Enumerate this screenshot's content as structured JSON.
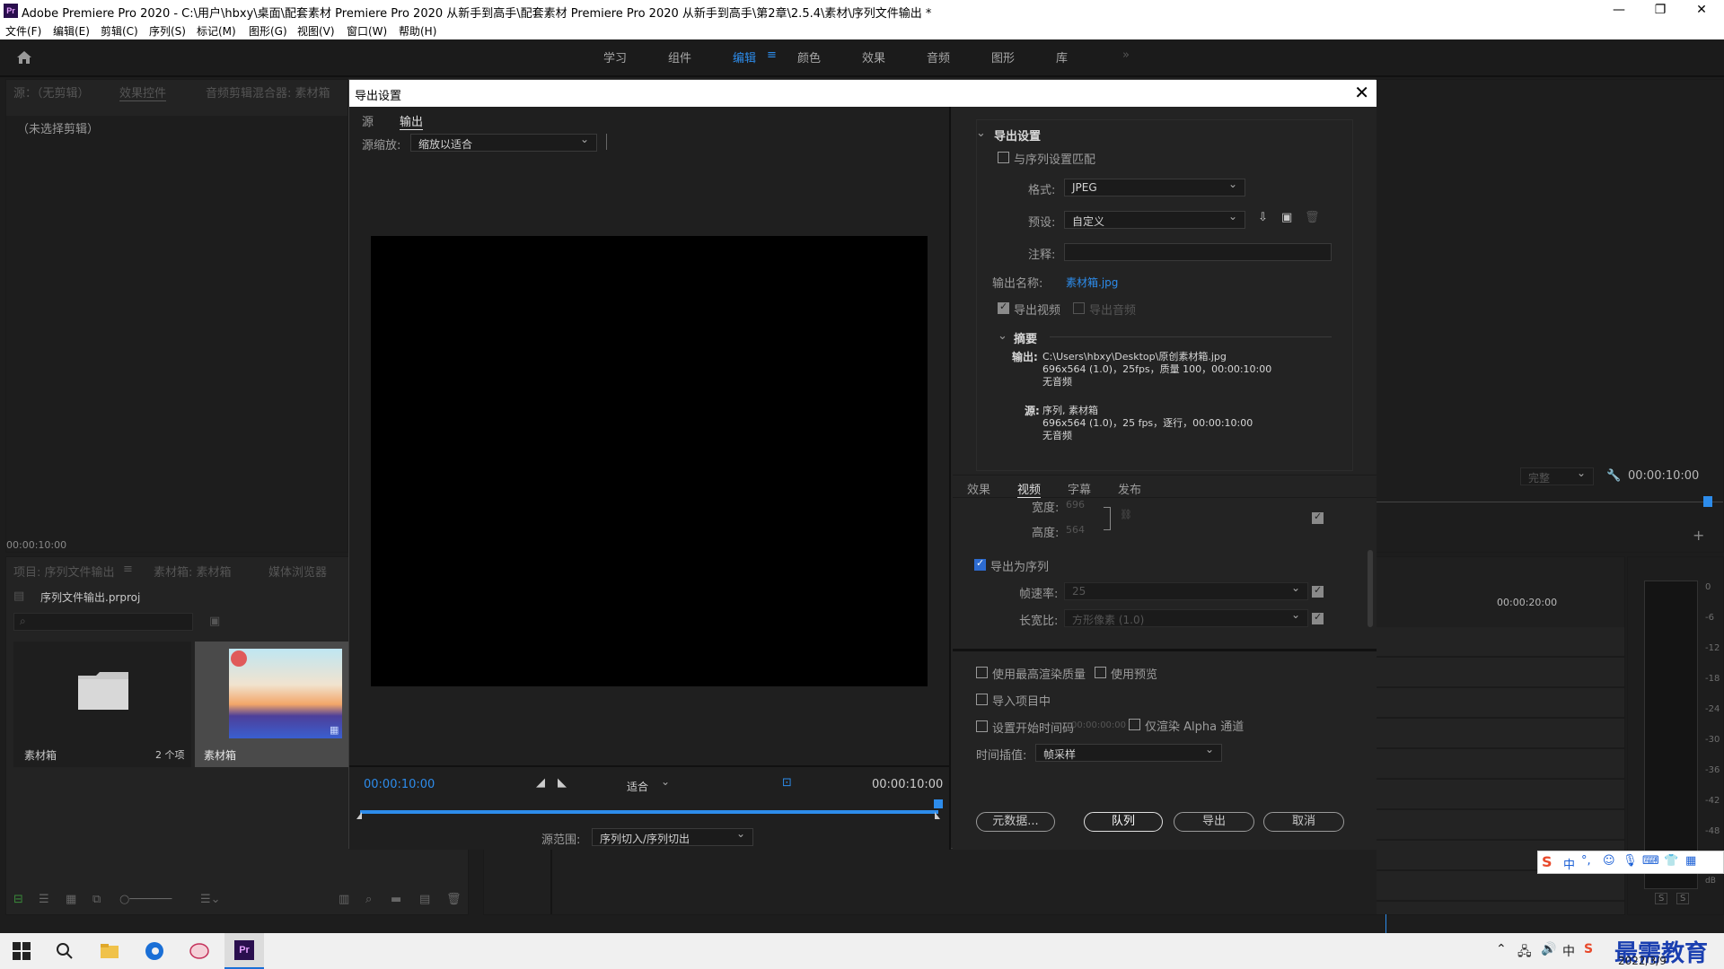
{
  "window": {
    "title": "Adobe Premiere Pro 2020 - C:\\用户\\hbxy\\桌面\\配套素材 Premiere Pro 2020 从新手到高手\\配套素材 Premiere Pro 2020 从新手到高手\\第2章\\2.5.4\\素材\\序列文件输出 *",
    "minimize": "—",
    "maximize": "❐",
    "close": "✕"
  },
  "menu": [
    "文件(F)",
    "编辑(E)",
    "剪辑(C)",
    "序列(S)",
    "标记(M)",
    "图形(G)",
    "视图(V)",
    "窗口(W)",
    "帮助(H)"
  ],
  "workspaces": [
    "学习",
    "组件",
    "编辑",
    "颜色",
    "效果",
    "音频",
    "图形",
    "库"
  ],
  "workspace_more": "»",
  "source_panel": {
    "tab_source": "源：（无剪辑）",
    "tab_effects": "效果控件",
    "tab_audio": "音频剪辑混合器: 素材箱",
    "no_clip": "（未选择剪辑）",
    "timecode": "00:00:10:00"
  },
  "project_panel": {
    "tab_project": "项目: 序列文件输出",
    "tab_bin": "素材箱: 素材箱",
    "tab_media": "媒体浏览器",
    "file_name": "序列文件输出.prproj",
    "bin_label": "素材箱",
    "bin_count": "2 个项",
    "clip_label": "素材箱"
  },
  "dialog": {
    "title": "导出设置",
    "close": "✕",
    "tab_source": "源",
    "tab_output": "输出",
    "source_scale_label": "源缩放:",
    "source_scale_value": "缩放以适合",
    "timecode_start": "00:00:10:00",
    "timecode_end": "00:00:10:00",
    "fit_value": "适合",
    "source_range_label": "源范围:",
    "source_range_value": "序列切入/序列切出"
  },
  "export_settings": {
    "header": "导出设置",
    "match_sequence": "与序列设置匹配",
    "format_label": "格式:",
    "format_value": "JPEG",
    "preset_label": "预设:",
    "preset_value": "自定义",
    "comment_label": "注释:",
    "output_name_label": "输出名称:",
    "output_name_value": "素材箱.jpg",
    "export_video": "导出视频",
    "export_audio": "导出音频",
    "summary_header": "摘要",
    "summary_output_label": "输出:",
    "summary_output_path": "C:\\Users\\hbxy\\Desktop\\原创素材箱.jpg",
    "summary_output_line2": "696x564 (1.0)，25fps，质量 100，00:00:10:00",
    "summary_output_line3": "无音频",
    "summary_source_label": "源:",
    "summary_source_line1": "序列, 素材箱",
    "summary_source_line2": "696x564 (1.0)，25 fps，逐行，00:00:10:00",
    "summary_source_line3": "无音频"
  },
  "video_tabs": [
    "效果",
    "视频",
    "字幕",
    "发布"
  ],
  "video_settings": {
    "width_label": "宽度:",
    "width_value": "696",
    "height_label": "高度:",
    "height_value": "564",
    "export_as_sequence": "导出为序列",
    "frame_rate_label": "帧速率:",
    "frame_rate_value": "25",
    "aspect_label": "长宽比:",
    "aspect_value": "方形像素 (1.0)"
  },
  "bottom_options": {
    "max_render": "使用最高渲染质量",
    "use_preview": "使用预览",
    "import_project": "导入项目中",
    "set_start_tc": "设置开始时间码",
    "start_tc_value": "00:00:00:00",
    "alpha_only": "仅渲染 Alpha 通道",
    "time_interp_label": "时间插值:",
    "time_interp_value": "帧采样"
  },
  "buttons": {
    "metadata": "元数据...",
    "queue": "队列",
    "export": "导出",
    "cancel": "取消"
  },
  "timeline": {
    "complete_label": "完整",
    "timecode": "00:00:10:00",
    "ruler_time": "00:00:20:00",
    "meter_labels": [
      "0",
      "-6",
      "-12",
      "-18",
      "-24",
      "-30",
      "-36",
      "-42",
      "-48",
      "dB"
    ],
    "solo_labels": [
      "S",
      "S"
    ]
  },
  "taskbar": {
    "date": "2022/3/9",
    "ime_label": "中",
    "watermark": "最需教育"
  },
  "colors": {
    "accent": "#2d8ceb",
    "panel_bg": "#232323",
    "dialog_bg": "#1f1f1f"
  }
}
